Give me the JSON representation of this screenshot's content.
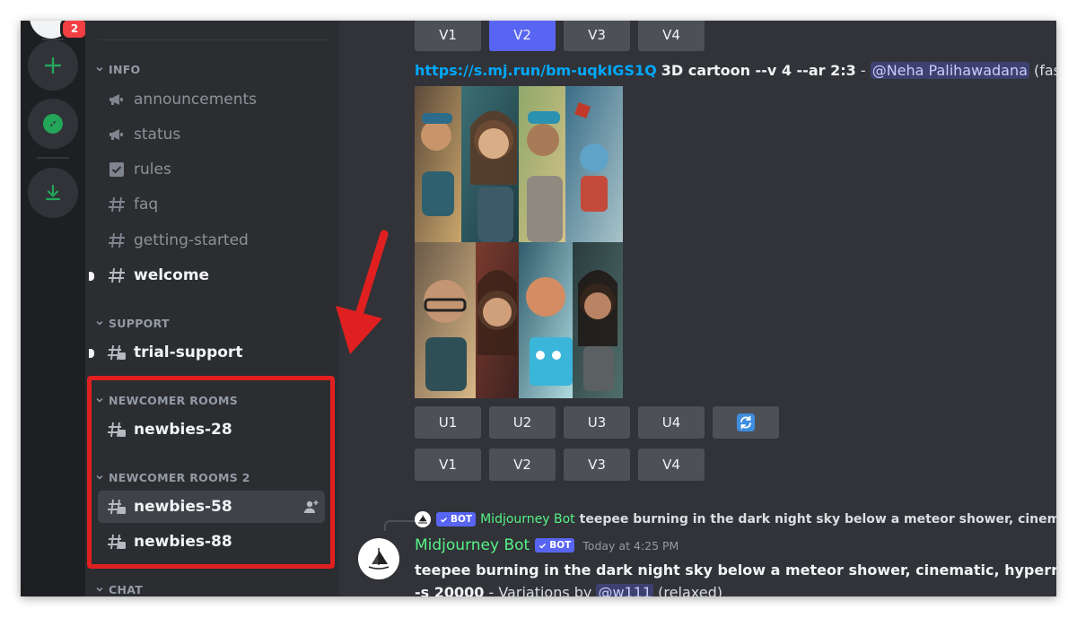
{
  "rail": {
    "badge_count": "2",
    "buttons": [
      {
        "name": "add-server",
        "icon": "plus-icon"
      },
      {
        "name": "explore",
        "icon": "compass-icon"
      },
      {
        "name": "download",
        "icon": "download-icon"
      }
    ]
  },
  "sidebar": {
    "categories": {
      "info": "INFO",
      "support": "SUPPORT",
      "newcomer": "NEWCOMER ROOMS",
      "newcomer2": "NEWCOMER ROOMS 2",
      "chat": "CHAT"
    },
    "channels": {
      "announcements": "announcements",
      "status": "status",
      "rules": "rules",
      "faq": "faq",
      "getting_started": "getting-started",
      "welcome": "welcome",
      "trial_support": "trial-support",
      "newbies28": "newbies-28",
      "newbies58": "newbies-58",
      "newbies88": "newbies-88"
    }
  },
  "main": {
    "top_buttons": [
      "V1",
      "V2",
      "V3",
      "V4"
    ],
    "prompt": {
      "link": "https://s.mj.run/bm-uqkIGS1Q",
      "text": "3D cartoon --v 4 --ar 2:3",
      "sep": " - ",
      "mention": "@Neha Palihawadana",
      "mode": "(fast)"
    },
    "upscale_buttons": [
      "U1",
      "U2",
      "U3",
      "U4"
    ],
    "variation_buttons": [
      "V1",
      "V2",
      "V3",
      "V4"
    ],
    "reply": {
      "badge": "BOT",
      "author": "Midjourney Bot",
      "text": "teepee burning in the dark night sky below a meteor shower, cinematic, hy"
    },
    "message": {
      "author": "Midjourney Bot",
      "badge": "BOT",
      "time": "Today at 4:25 PM",
      "line1": "teepee burning in the dark night sky below a meteor shower, cinematic, hyperrealistic, h",
      "line2_start": "-s 20000",
      "line2_mid": " - Variations by ",
      "mention": "@w111",
      "mode": " (relaxed)"
    }
  },
  "colors": {
    "accent": "#5865f2",
    "bot_green": "#57f287",
    "link": "#00a8fc",
    "annotation_red": "#e02020"
  }
}
